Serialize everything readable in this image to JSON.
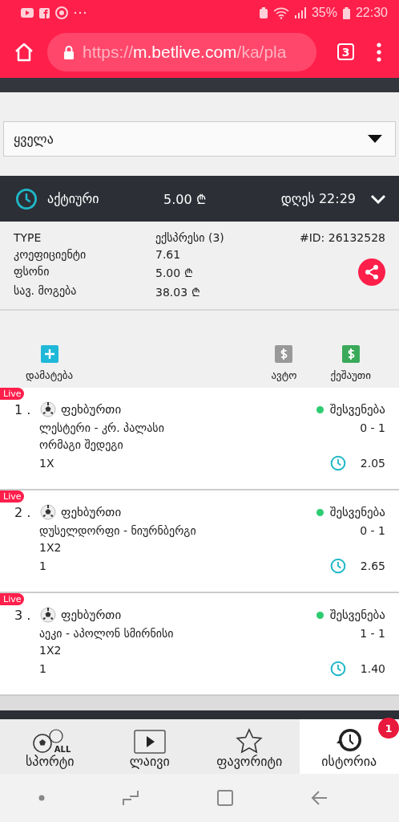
{
  "status_bar": {
    "battery": "35%",
    "time": "22:30"
  },
  "browser": {
    "url_scheme": "https://",
    "url_host": "m.betlive.com",
    "url_path": "/ka/pla",
    "tab_count": "3"
  },
  "filter": {
    "value": "ყველა"
  },
  "bet": {
    "status": "აქტიური",
    "stake": "5.00 ₾",
    "date": "დღეს 22:29",
    "expanded": false,
    "details": [
      {
        "label": "TYPE",
        "value": "ექსპრესი (3)"
      },
      {
        "label": "კოეფიციენტი",
        "value": "7.61"
      },
      {
        "label": "ფსონი",
        "value": "5.00 ₾"
      },
      {
        "label": "სავ. მოგება",
        "value": "38.03 ₾"
      }
    ],
    "id": "#ID: 26132528"
  },
  "actions": [
    {
      "label": "დამატება",
      "kind": "add"
    },
    {
      "label": "ავტო",
      "kind": "auto"
    },
    {
      "label": "ქეშაუთი",
      "kind": "cashout"
    }
  ],
  "events": [
    {
      "badge": "Live",
      "number": "1 .",
      "sport": "ფეხბურთი",
      "status": "შესვენება",
      "color": "#2ecc71",
      "teams": "ლესტერი - კრ. პალასი",
      "score": "0 - 1",
      "market": "ორმაგი შედეგი",
      "pick": "1X",
      "odds": "2.05"
    },
    {
      "badge": "Live",
      "number": "2 .",
      "sport": "ფეხბურთი",
      "status": "შესვენება",
      "color": "#2ecc71",
      "teams": "დუსელდორფი - ნიურნბერგი",
      "score": "0 - 1",
      "market": "1X2",
      "pick": "1",
      "odds": "2.65"
    },
    {
      "badge": "Live",
      "number": "3 .",
      "sport": "ფეხბურთი",
      "status": "შესვენება",
      "color": "#2ecc71",
      "teams": "აეკი - აპოლონ სმირნისი",
      "score": "1 - 1",
      "market": "1X2",
      "pick": "1",
      "odds": "1.40"
    }
  ],
  "nav": [
    {
      "label": "სპორტი",
      "kind": "sports",
      "icon_text": "ALL",
      "selected": false
    },
    {
      "label": "ლაივი",
      "kind": "live",
      "selected": false
    },
    {
      "label": "ფავორიტი",
      "kind": "favorite",
      "selected": false
    },
    {
      "label": "ისტორია",
      "kind": "history",
      "selected": true,
      "badge": "1"
    }
  ]
}
